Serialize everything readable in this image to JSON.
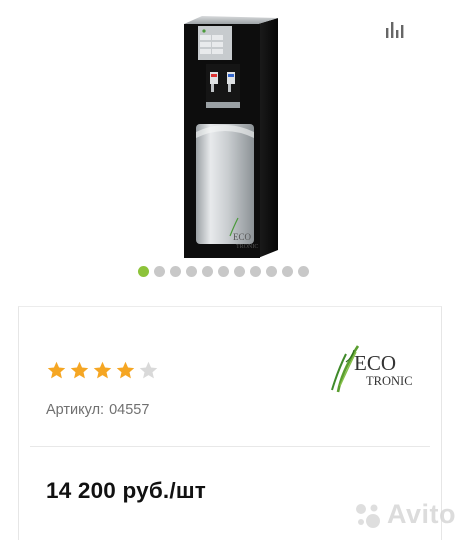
{
  "gallery": {
    "slide_count": 11,
    "active_slide": 1,
    "product_logo_text": [
      "ECO",
      "TRONIC"
    ],
    "compare_icon": "bar-chart-icon"
  },
  "product": {
    "rating": 4,
    "rating_max": 5,
    "sku_label": "Артикул:",
    "sku_value": "04557",
    "price": "14 200 руб./шт",
    "brand": {
      "line1": "ECO",
      "line2": "TRONIC"
    }
  },
  "watermark": {
    "text": "Avito"
  },
  "colors": {
    "star_filled": "#f5a623",
    "star_empty": "#d9d9d9",
    "dot_active": "#8dc33a",
    "dot_inactive": "#c8c8c8",
    "brand_green": "#5a9e2f",
    "text_muted": "#707070"
  }
}
